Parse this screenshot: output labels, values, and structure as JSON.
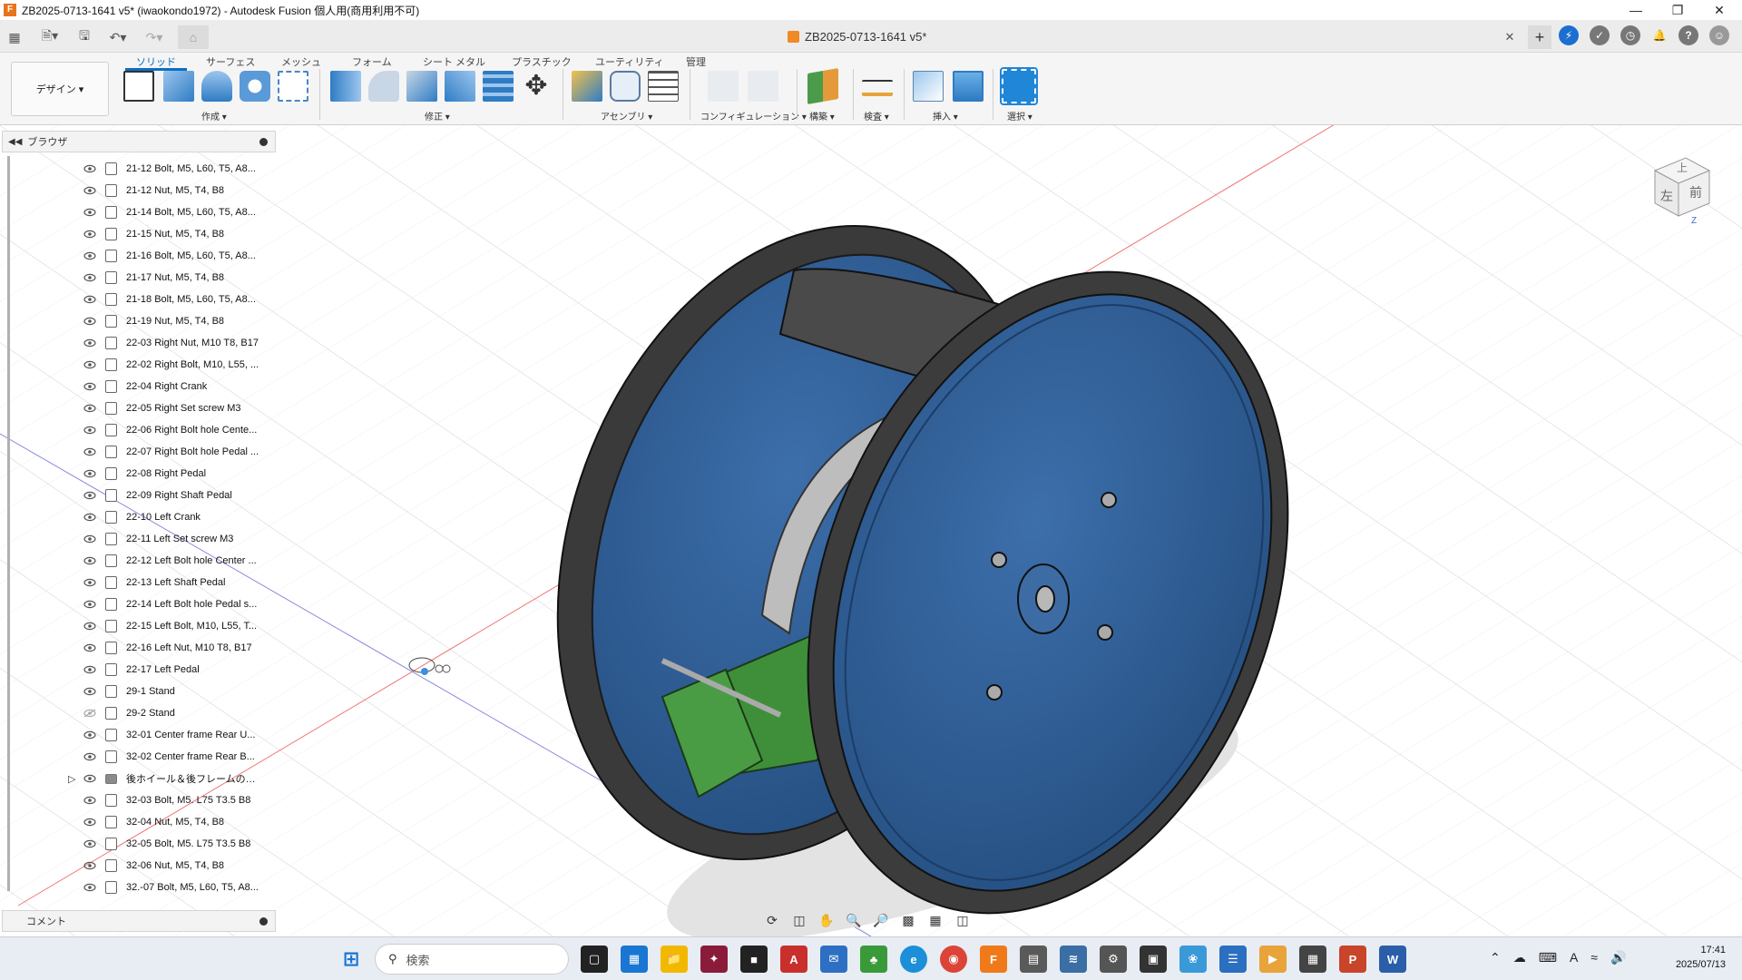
{
  "window": {
    "title": "ZB2025-0713-1641 v5* (iwaokondo1972) - Autodesk Fusion 個人用(商用利用不可)"
  },
  "document_tab": {
    "name": "ZB2025-0713-1641 v5*",
    "close": "✕"
  },
  "ribbon": {
    "workspace_label": "デザイン ▾",
    "tabs": [
      "ソリッド",
      "サーフェス",
      "メッシュ",
      "フォーム",
      "シート メタル",
      "プラスチック",
      "ユーティリティ",
      "管理"
    ],
    "groups": [
      "作成 ▾",
      "修正 ▾",
      "アセンブリ ▾",
      "コンフィギュレーション ▾",
      "構築 ▾",
      "検査 ▾",
      "挿入 ▾",
      "選択 ▾"
    ]
  },
  "browser": {
    "title": "ブラウザ",
    "items": [
      {
        "label": "21-12 Bolt, M5, L60, T5, A8...",
        "visible": true
      },
      {
        "label": "21-12 Nut, M5, T4, B8",
        "visible": true
      },
      {
        "label": "21-14 Bolt, M5, L60, T5, A8...",
        "visible": true
      },
      {
        "label": "21-15 Nut, M5, T4, B8",
        "visible": true
      },
      {
        "label": "21-16 Bolt, M5, L60, T5, A8...",
        "visible": true
      },
      {
        "label": "21-17 Nut, M5, T4, B8",
        "visible": true
      },
      {
        "label": "21-18 Bolt, M5, L60, T5, A8...",
        "visible": true
      },
      {
        "label": "21-19 Nut, M5, T4, B8",
        "visible": true
      },
      {
        "label": "22-03 Right Nut, M10 T8, B17",
        "visible": true
      },
      {
        "label": "22-02 Right Bolt, M10, L55, ...",
        "visible": true
      },
      {
        "label": "22-04 Right Crank",
        "visible": true
      },
      {
        "label": "22-05 Right Set screw M3",
        "visible": true
      },
      {
        "label": "22-06 Right Bolt hole Cente...",
        "visible": true
      },
      {
        "label": "22-07 Right Bolt hole Pedal ...",
        "visible": true
      },
      {
        "label": "22-08 Right Pedal",
        "visible": true
      },
      {
        "label": "22-09 Right Shaft Pedal",
        "visible": true
      },
      {
        "label": "22-10 Left Crank",
        "visible": true
      },
      {
        "label": "22-11 Left Set screw M3",
        "visible": true
      },
      {
        "label": "22-12 Left Bolt hole Center ...",
        "visible": true
      },
      {
        "label": "22-13 Left Shaft Pedal",
        "visible": true
      },
      {
        "label": "22-14 Left Bolt hole Pedal s...",
        "visible": true
      },
      {
        "label": "22-15 Left Bolt, M10, L55, T...",
        "visible": true
      },
      {
        "label": "22-16 Left Nut, M10 T8, B17",
        "visible": true
      },
      {
        "label": "22-17 Left Pedal",
        "visible": true
      },
      {
        "label": "29-1 Stand",
        "visible": true
      },
      {
        "label": "29-2 Stand",
        "visible": false
      },
      {
        "label": "32-01 Center frame Rear U...",
        "visible": true
      },
      {
        "label": "32-02 Center frame Rear B...",
        "visible": true
      },
      {
        "label": "後ホイール＆後フレームのベアリ...",
        "visible": true,
        "folder": true
      },
      {
        "label": "32-03 Bolt, M5. L75 T3.5 B8",
        "visible": true
      },
      {
        "label": "32-04 Nut, M5, T4, B8",
        "visible": true
      },
      {
        "label": "32-05 Bolt, M5. L75 T3.5 B8",
        "visible": true
      },
      {
        "label": "32-06 Nut, M5, T4, B8",
        "visible": true
      },
      {
        "label": "32.-07 Bolt, M5, L60, T5, A8...",
        "visible": true
      }
    ]
  },
  "comments": {
    "title": "コメント"
  },
  "viewcube": {
    "top": "上",
    "left": "左",
    "front": "前",
    "axis": "Z"
  },
  "taskbar": {
    "search_placeholder": "検索",
    "time": "17:41",
    "date": "2025/07/13"
  },
  "colors": {
    "accent": "#0a6fc2",
    "wheel_blue": "#2f5f98",
    "frame_green": "#3f8f3a",
    "tire": "#3a3a3a",
    "seat": "#4a4a4a"
  }
}
